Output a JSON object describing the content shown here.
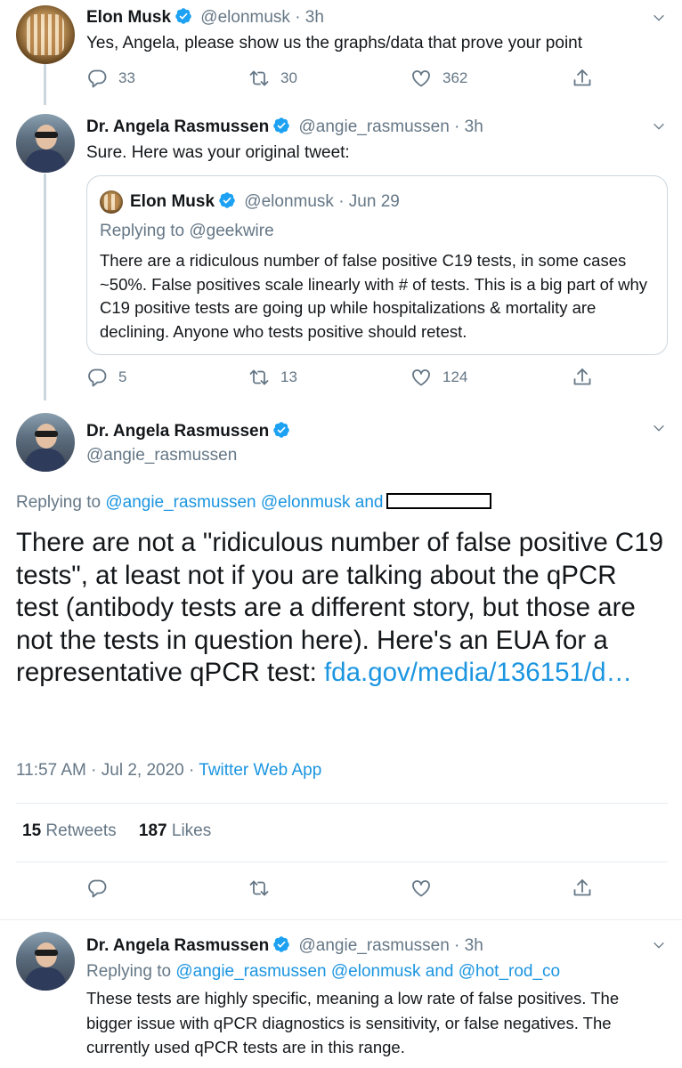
{
  "tweet1": {
    "name": "Elon Musk",
    "handle": "@elonmusk",
    "time": "· 3h",
    "text": "Yes, Angela, please show us the graphs/data that prove your point",
    "replies": "33",
    "retweets": "30",
    "likes": "362"
  },
  "tweet2": {
    "name": "Dr. Angela Rasmussen",
    "handle": "@angie_rasmussen",
    "time": "· 3h",
    "text": "Sure. Here was your original tweet:",
    "replies": "5",
    "retweets": "13",
    "likes": "124",
    "quote": {
      "name": "Elon Musk",
      "handle": "@elonmusk",
      "time": "· Jun 29",
      "replying_prefix": "Replying to ",
      "replying_to": "@geekwire",
      "text": "There are a ridiculous number of false positive C19 tests, in some cases ~50%. False positives scale linearly with # of tests. This is a big part of why C19 positive tests are going up while hospitalizations & mortality are declining. Anyone who tests positive should retest."
    }
  },
  "main": {
    "name": "Dr. Angela Rasmussen",
    "handle": "@angie_rasmussen",
    "replying_prefix": "Replying to ",
    "replying_to": "@angie_rasmussen @elonmusk and",
    "text": "There are not a \"ridiculous number of false positive C19 tests\", at least not if you are talking about the qPCR test (antibody tests are a different story, but those are not the tests in question here). Here's an EUA for a representative qPCR test:",
    "link": "fda.gov/media/136151/d…",
    "timestamp": "11:57 AM · Jul 2, 2020 · ",
    "source": "Twitter Web App",
    "retweets_count": "15",
    "retweets_label": "Retweets",
    "likes_count": "187",
    "likes_label": "Likes"
  },
  "tweet4": {
    "name": "Dr. Angela Rasmussen",
    "handle": "@angie_rasmussen",
    "time": "· 3h",
    "replying_prefix": "Replying to ",
    "replying_to": "@angie_rasmussen @elonmusk and @hot_rod_co",
    "text": "These tests are highly specific, meaning a low rate of false positives. The bigger issue with qPCR diagnostics is sensitivity, or false negatives. The currently used qPCR tests are in this range."
  },
  "colors": {
    "accent": "#1b95e0",
    "secondary": "#657786",
    "divider": "#e6ecf0"
  },
  "icons": [
    "verified-badge-icon",
    "chevron-down-icon",
    "reply-icon",
    "retweet-icon",
    "like-icon",
    "share-icon"
  ]
}
